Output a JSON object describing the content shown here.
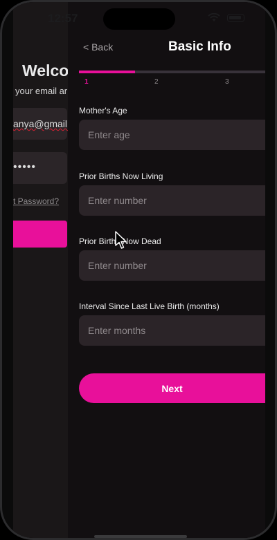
{
  "status_bar": {
    "time": "12:57"
  },
  "login_screen": {
    "welcome": "Welco",
    "subtitle": "your email ar",
    "email_value": "anya@gmail.",
    "password_value": "•••••",
    "forgot_password": "t Password?"
  },
  "nav": {
    "back_label": "< Back",
    "title": "Basic Info"
  },
  "progress": {
    "fraction": 0.3,
    "steps": [
      "1",
      "2",
      "3"
    ],
    "active_step": 1
  },
  "form": {
    "mothers_age": {
      "label": "Mother's Age",
      "placeholder": "Enter age"
    },
    "prior_births_living": {
      "label": "Prior Births Now Living",
      "placeholder": "Enter number"
    },
    "prior_births_dead": {
      "label": "Prior Births Now Dead",
      "placeholder": "Enter number"
    },
    "interval": {
      "label": "Interval Since Last Live Birth (months)",
      "placeholder": "Enter months"
    }
  },
  "next_button": {
    "label": "Next"
  },
  "colors": {
    "accent": "#e8109a",
    "background": "#120f11",
    "field": "#2b2428"
  },
  "icons": [
    "wifi-icon",
    "battery-icon",
    "mouse-cursor-icon"
  ]
}
